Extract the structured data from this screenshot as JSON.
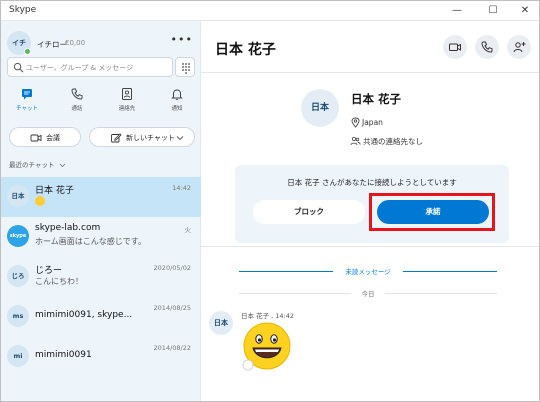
{
  "window": {
    "title": "Skype",
    "controls": [
      "—",
      "☐",
      "✕"
    ]
  },
  "profile": {
    "initials": "イチ",
    "name": "イチロー",
    "credit": "€0,00",
    "more": "•••"
  },
  "search": {
    "placeholder": "ユーザー、グループ & メッセージ"
  },
  "tabs": [
    {
      "label": "チャット",
      "icon": "chat-icon",
      "active": true
    },
    {
      "label": "通話",
      "icon": "phone-icon",
      "active": false
    },
    {
      "label": "連絡先",
      "icon": "contacts-icon",
      "active": false
    },
    {
      "label": "通知",
      "icon": "bell-icon",
      "active": false
    }
  ],
  "actions": {
    "meeting": "会議",
    "new_chat": "新しいチャット"
  },
  "recent_header": "最近のチャット",
  "chats": [
    {
      "initials": "日本",
      "name": "日本 花子",
      "message": "",
      "time": "14:42",
      "selected": true,
      "emoji": true
    },
    {
      "initials": "skype",
      "name": "skype-lab.com",
      "message": "ホーム画面はこんな感じです。",
      "time": "火",
      "selected": false
    },
    {
      "initials": "じろ",
      "name": "じろー",
      "message": "こんにちわ！",
      "time": "2020/05/02",
      "selected": false
    },
    {
      "initials": "ms",
      "name": "mimimi0091, skype...",
      "message": "",
      "time": "2014/08/25",
      "selected": false
    },
    {
      "initials": "mi",
      "name": "mimimi0091",
      "message": "",
      "time": "2014/08/22",
      "selected": false
    }
  ],
  "main": {
    "title": "日本 花子",
    "contact": {
      "initials": "日本",
      "name": "日本 花子",
      "location": "Japan",
      "shared": "共通の連絡先なし"
    },
    "request": {
      "text": "日本 花子 さんがあなたに接続しようとしています",
      "block_label": "ブロック",
      "accept_label": "承諾"
    },
    "unread_label": "未読メッセージ",
    "today_label": "今日",
    "message": {
      "initials": "日本",
      "meta": "日本 花子 , 14:42"
    }
  },
  "colors": {
    "accent": "#0078d4",
    "highlight": "#e8141a",
    "sidebar_bg": "#eef5fa",
    "selected_bg": "#c6e4f8"
  }
}
